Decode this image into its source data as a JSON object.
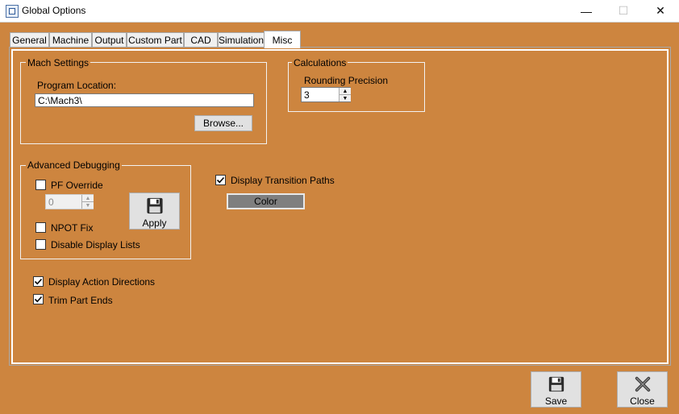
{
  "window": {
    "title": "Global Options",
    "icon": "app-window-icon",
    "controls": {
      "minimize": "—",
      "maximize": "☐",
      "close": "✕"
    }
  },
  "colors": {
    "background": "#cd853f",
    "frame": "#ffffff",
    "color_button": "#7f7f7f"
  },
  "tabs": [
    {
      "label": "General",
      "active": false
    },
    {
      "label": "Machine",
      "active": false
    },
    {
      "label": "Output",
      "active": false
    },
    {
      "label": "Custom Part",
      "active": false
    },
    {
      "label": "CAD",
      "active": false
    },
    {
      "label": "Simulation",
      "active": false
    },
    {
      "label": "Misc",
      "active": true
    }
  ],
  "mach_settings": {
    "group_label": "Mach Settings",
    "program_location_label": "Program Location:",
    "program_location_value": "C:\\Mach3\\",
    "browse_label": "Browse..."
  },
  "calculations": {
    "group_label": "Calculations",
    "rounding_label": "Rounding Precision",
    "rounding_value": "3"
  },
  "advanced_debugging": {
    "group_label": "Advanced Debugging",
    "pf_override_label": "PF Override",
    "pf_override_checked": false,
    "pf_value": "0",
    "npot_fix_label": "NPOT Fix",
    "npot_fix_checked": false,
    "disable_display_lists_label": "Disable Display Lists",
    "disable_display_lists_checked": false,
    "apply_label": "Apply"
  },
  "display_transition_paths": {
    "label": "Display Transition Paths",
    "checked": true,
    "color_label": "Color"
  },
  "display_action_directions": {
    "label": "Display Action Directions",
    "checked": true
  },
  "trim_part_ends": {
    "label": "Trim Part Ends",
    "checked": true
  },
  "footer": {
    "save_label": "Save",
    "close_label": "Close"
  }
}
